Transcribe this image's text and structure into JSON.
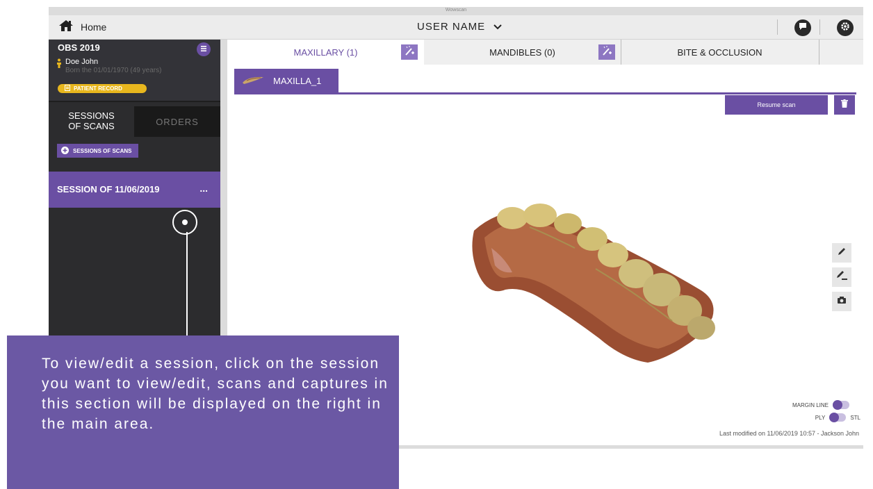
{
  "window": {
    "title": "Wowscan"
  },
  "header": {
    "home_label": "Home",
    "user_name": "USER NAME",
    "chat_icon": "chat-icon",
    "settings_icon": "gear-icon"
  },
  "patient": {
    "case_title": "OBS 2019",
    "name": "Doe John",
    "birth": "Born the 01/01/1970 (49 years)",
    "record_label": "PATIENT RECORD"
  },
  "sidebar": {
    "tabs": [
      {
        "label": "SESSIONS\nOF SCANS",
        "active": true
      },
      {
        "label": "ORDERS",
        "active": false
      }
    ],
    "add_session_label": "SESSIONS OF SCANS",
    "sessions": [
      {
        "label": "SESSION OF 11/06/2019",
        "more": "..."
      }
    ]
  },
  "main": {
    "tabs": [
      {
        "label": "MAXILLARY (1)",
        "active": true
      },
      {
        "label": "MANDIBLES (0)",
        "active": false
      },
      {
        "label": "BITE & OCCLUSION",
        "active": false
      }
    ],
    "scan_tab": "MAXILLA_1",
    "resume_label": "Resume scan",
    "toggles": {
      "margin_line": "MARGIN LINE",
      "ply": "PLY",
      "stl": "STL"
    },
    "last_modified": "Last modified on 11/06/2019 10:57 - Jackson John"
  },
  "callout": {
    "text": "To view/edit a session, click on the session you want to view/edit, scans and captures in this section will be displayed on the right in the main area."
  },
  "colors": {
    "accent": "#6a4fa3",
    "callout_bg": "#6b58a4",
    "sidebar_bg": "#2c2c2e",
    "record_badge": "#e8b71e"
  }
}
